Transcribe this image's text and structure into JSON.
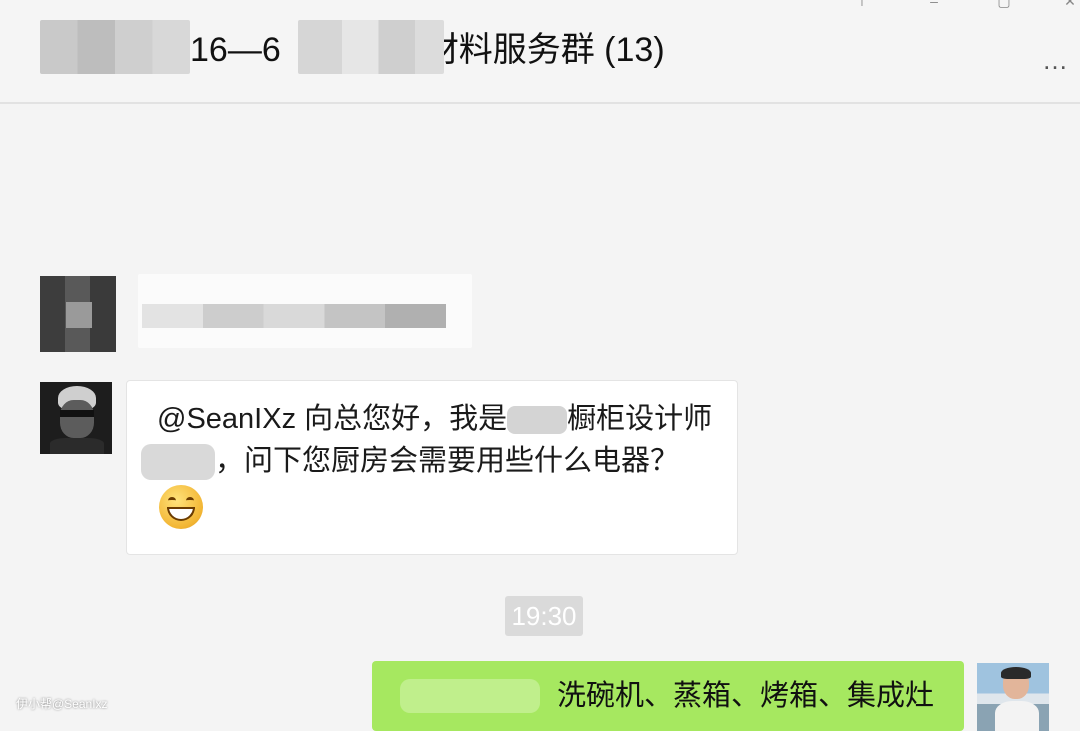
{
  "window": {
    "title_visible_part": "16—6",
    "title_suffix": "材料服务群 (13)",
    "more_icon_glyph": "…"
  },
  "messages": {
    "incoming": {
      "line1": "@SeanIXz 向总您好，我是",
      "line1_end": "橱柜设计师",
      "line2": "，问下您厨房会需要用些什么电器？",
      "emoji": "grinning-face-icon"
    },
    "timestamp": "19:30",
    "outgoing": {
      "text": "洗碗机、蒸箱、烤箱、集成灶"
    }
  },
  "watermark": "伊小帮@SeanIxz",
  "colors": {
    "outgoing_bubble": "#a6e860",
    "incoming_bubble": "#ffffff",
    "background": "#f4f4f4"
  }
}
